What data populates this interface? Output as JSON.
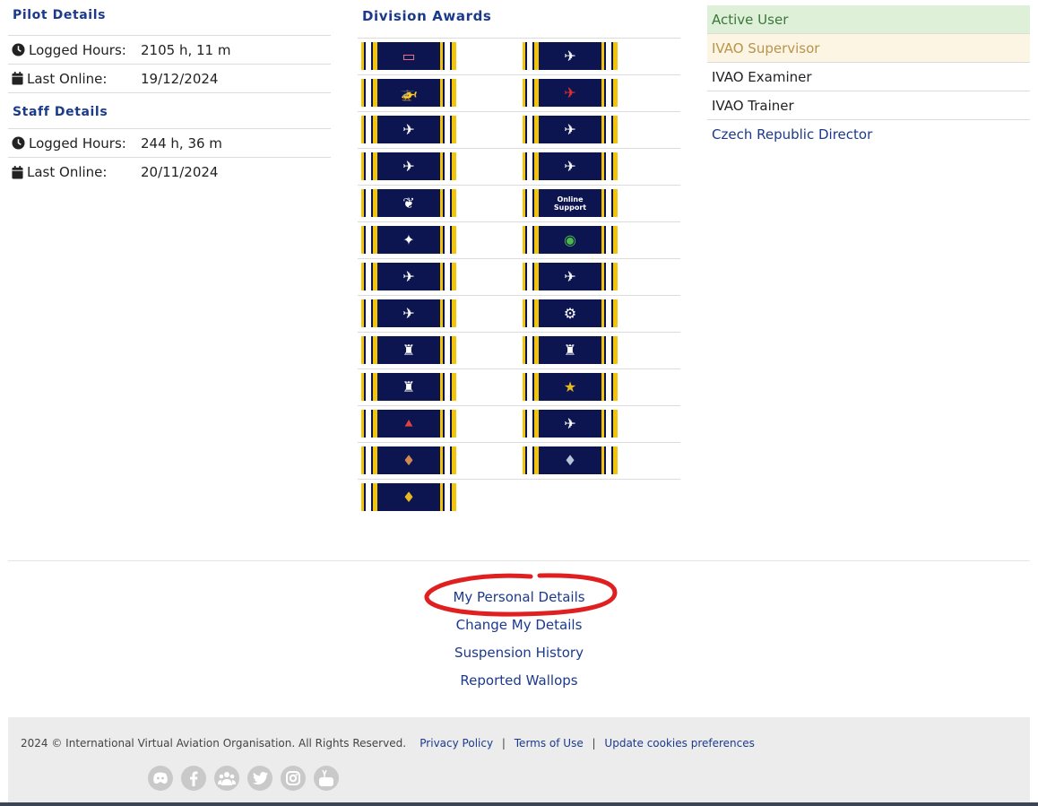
{
  "pilot": {
    "title": "Pilot Details",
    "hours_label": "Logged Hours:",
    "hours_value": "2105 h, 11 m",
    "online_label": "Last Online:",
    "online_value": "19/12/2024"
  },
  "staff": {
    "title": "Staff Details",
    "hours_label": "Logged Hours:",
    "hours_value": "244 h, 36 m",
    "online_label": "Last Online:",
    "online_value": "20/11/2024"
  },
  "awards": {
    "title": "Division Awards",
    "items": [
      {
        "icon": "runway-icon"
      },
      {
        "icon": "cessna-icon"
      },
      {
        "icon": "helicopter-icon"
      },
      {
        "icon": "biplane-icon"
      },
      {
        "icon": "plane-warning-icon"
      },
      {
        "icon": "plane-icon"
      },
      {
        "icon": "hangar-plane-icon"
      },
      {
        "icon": "seaplane-icon"
      },
      {
        "icon": "laurel-emblem-icon"
      },
      {
        "icon": "online-support-icon",
        "label": "Online Support"
      },
      {
        "icon": "stage-lights-icon"
      },
      {
        "icon": "radar-icon"
      },
      {
        "icon": "concorde-icon"
      },
      {
        "icon": "contrails-icon"
      },
      {
        "icon": "business-jet-icon"
      },
      {
        "icon": "gears-icon"
      },
      {
        "icon": "atc-tower-icon"
      },
      {
        "icon": "atc-tower-icon"
      },
      {
        "icon": "atc-tower-icon"
      },
      {
        "icon": "gold-wings-stars-icon"
      },
      {
        "icon": "tail-fins-icon"
      },
      {
        "icon": "airliner-icon"
      },
      {
        "icon": "bronze-wings-icon"
      },
      {
        "icon": "silver-wings-icon"
      },
      {
        "icon": "gold-wings-icon"
      }
    ]
  },
  "roles": {
    "active": "Active User",
    "supervisor": "IVAO Supervisor",
    "examiner": "IVAO Examiner",
    "trainer": "IVAO Trainer",
    "director": "Czech Republic Director"
  },
  "links": {
    "personal": "My Personal Details",
    "change": "Change My Details",
    "suspension": "Suspension History",
    "wallops": "Reported Wallops"
  },
  "footer": {
    "copyright": "2024 © International Virtual Aviation Organisation. All Rights Reserved.",
    "privacy": "Privacy Policy",
    "sep": "|",
    "terms": "Terms of Use",
    "cookies": "Update cookies preferences",
    "social": [
      "discord-icon",
      "facebook-icon",
      "community-icon",
      "twitter-icon",
      "instagram-icon",
      "youtube-icon"
    ]
  },
  "colors": {
    "link": "#1b3a8c",
    "active_bg": "#dff0d8",
    "active_fg": "#3c763d",
    "supervisor_bg": "#fcf5e3",
    "supervisor_fg": "#b8944c",
    "annotation": "#e02020"
  }
}
